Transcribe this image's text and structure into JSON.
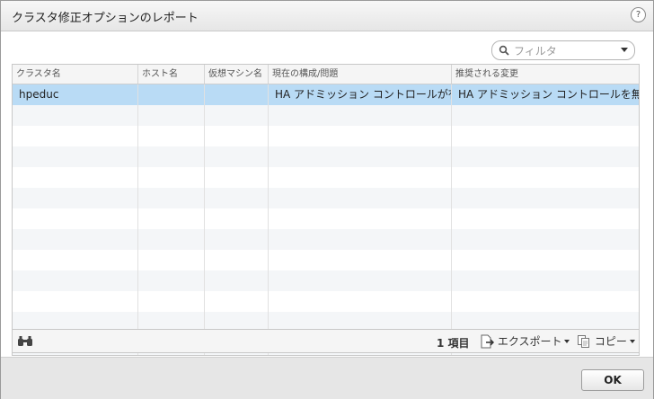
{
  "dialog": {
    "title": "クラスタ修正オプションのレポート",
    "help_icon": "?"
  },
  "filter": {
    "placeholder": "フィルタ",
    "icon": "search-icon"
  },
  "table": {
    "columns": [
      "クラスタ名",
      "ホスト名",
      "仮想マシン名",
      "現在の構成/問題",
      "推奨される変更"
    ],
    "rows": [
      [
        "hpeduc",
        "",
        "",
        "HA アドミッション コントロールが有...",
        "HA アドミッション コントロールを無効..."
      ]
    ],
    "selected_row": 0
  },
  "footer": {
    "find_icon": "binoculars-icon",
    "count": "1 項目",
    "export_label": "エクスポート",
    "copy_label": "コピー"
  },
  "buttons": {
    "ok": "OK"
  },
  "colors": {
    "selected_row": "#b9dbf5",
    "alt_row": "#f4f6f8"
  }
}
